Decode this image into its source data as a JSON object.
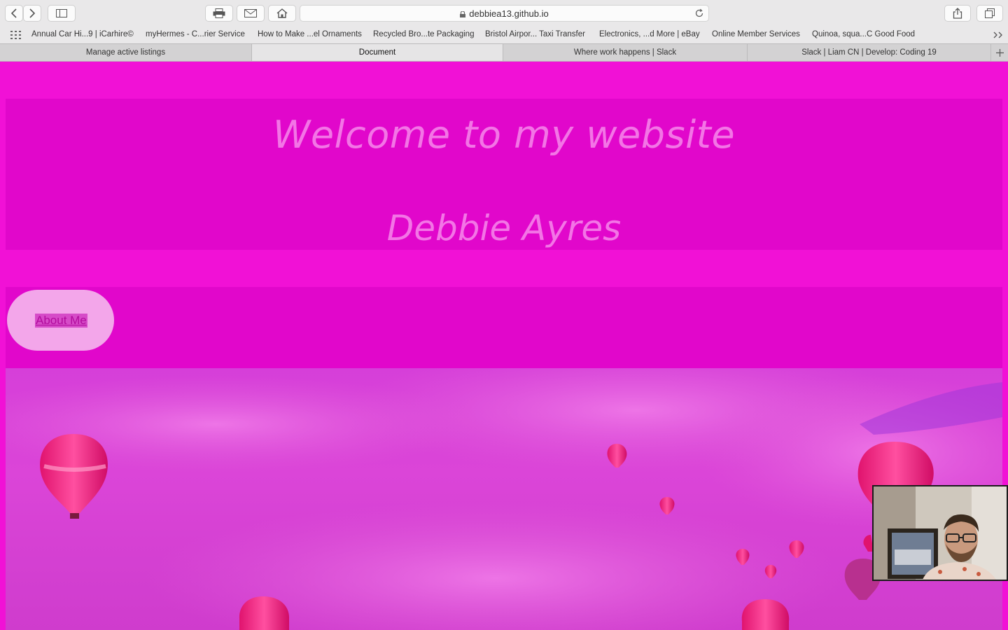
{
  "browser": {
    "url": "debbiea13.github.io",
    "bookmarks": [
      "Annual Car Hi...9 | iCarhire©",
      "myHermes - C...rier Service",
      "How to Make ...el Ornaments",
      "Recycled Bro...te Packaging",
      "Bristol Airpor... Taxi Transfer",
      "Electronics, ...d More | eBay",
      "Online Member Services",
      "Quinoa, squa...C Good Food"
    ],
    "tabs": [
      {
        "label": "Manage active listings",
        "active": false
      },
      {
        "label": "Document",
        "active": true
      },
      {
        "label": "Where work happens | Slack",
        "active": false
      },
      {
        "label": "Slack | Liam CN | Develop: Coding 19",
        "active": false
      }
    ]
  },
  "page": {
    "welcome": "Welcome to my website",
    "name": "Debbie Ayres",
    "about_button": "About Me"
  },
  "colors": {
    "page_bg": "#f111d6",
    "box_bg": "#e107cb",
    "heading_text": "#f375e6",
    "button_bg": "#f3a6ea"
  }
}
